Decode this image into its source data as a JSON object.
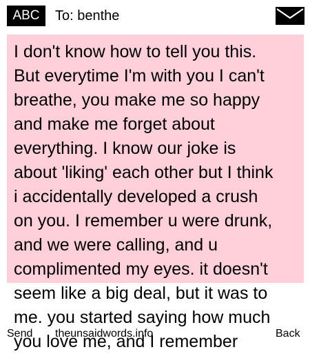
{
  "header": {
    "mode": "ABC",
    "to_prefix": "To:",
    "recipient": "benthe",
    "icon": "envelope-icon"
  },
  "message": {
    "body": "I don't know how to tell you this.\nBut everytime I'm with you I can't\nbreathe, you make me so happy\nand make me forget about\neverything. I know our joke is\nabout 'liking' each other but I think\ni accidentally developed a crush\non you. I remember u were drunk,\nand we were calling, and u\ncomplimented my eyes. it doesn't\nseem like a big deal, but it was to\nme. you started saying how much\nyou love me, and I remember",
    "background_color": "#ffd0d9"
  },
  "softkeys": {
    "left": "Send",
    "center": "theunsaidwords.info",
    "right": "Back"
  }
}
